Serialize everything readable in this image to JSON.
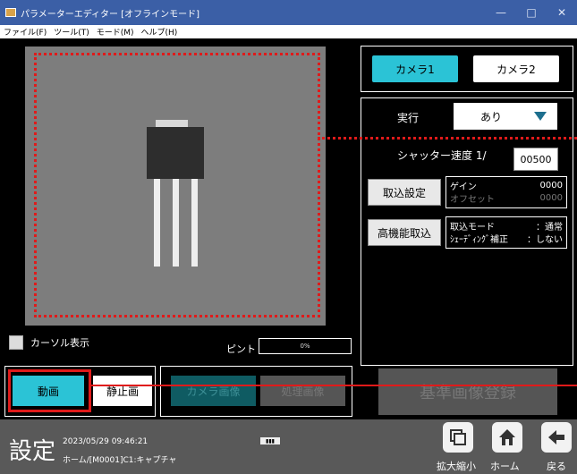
{
  "window": {
    "title": "パラメーターエディター [オフラインモード]",
    "minimize": "—",
    "maximize": "□",
    "close": "✕"
  },
  "menu": [
    "ファイル(F)",
    "ツール(T)",
    "モード(M)",
    "ヘルプ(H)"
  ],
  "view": {
    "cursor_label": "カーソル表示",
    "focus_label": "ピント",
    "focus_value": "0%"
  },
  "camera_tabs": {
    "cam1": "カメラ1",
    "cam2": "カメラ2"
  },
  "settings": {
    "exec_label": "実行",
    "exec_value": "あり",
    "shutter_label": "シャッター速度 1/",
    "shutter_value": "00500",
    "capture_btn": "取込設定",
    "gain_label": "ゲイン",
    "gain_value": "0000",
    "offset_label": "オフセット",
    "offset_value": "0000",
    "hp_btn": "高機能取込",
    "mode_label": "取込モード",
    "mode_value": "：通常",
    "shading_label": "ｼｪｰﾃﾞｨﾝｸﾞ補正",
    "shading_value": "：しない"
  },
  "buttons": {
    "video": "動画",
    "still": "静止画",
    "camera_image": "カメラ画像",
    "processed_image": "処理画像",
    "register": "基準画像登録"
  },
  "status": {
    "title": "設定",
    "datetime": "2023/05/29 09:46:21",
    "path": "ホーム/[M0001]C1:キャプチャ",
    "badge": "▮▮▮"
  },
  "nav": {
    "zoom": "拡大縮小",
    "home": "ホーム",
    "back": "戻る"
  },
  "colors": {
    "accent": "#2bc3d6",
    "highlight": "#e01a1a",
    "titlebar": "#3b5fa6"
  }
}
